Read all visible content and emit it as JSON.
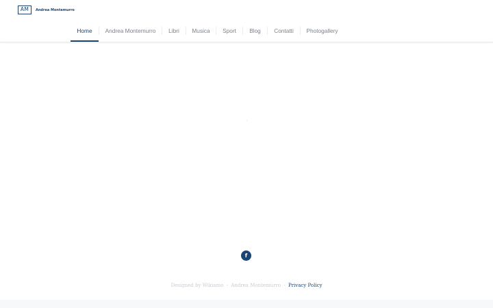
{
  "logo": {
    "mark": "AM",
    "text": "Andrea Montemurro"
  },
  "nav": {
    "items": [
      {
        "label": "Home",
        "active": true
      },
      {
        "label": "Andrea Montemurro",
        "active": false
      },
      {
        "label": "Libri",
        "active": false
      },
      {
        "label": "Musica",
        "active": false
      },
      {
        "label": "Sport",
        "active": false
      },
      {
        "label": "Blog",
        "active": false
      },
      {
        "label": "Contatti",
        "active": false
      },
      {
        "label": "Photogallery",
        "active": false
      }
    ]
  },
  "social": {
    "facebook_glyph": "f",
    "icon": "facebook-icon"
  },
  "footer": {
    "designed_by": "Designed by Wikiamo",
    "separator": "-",
    "owner": "Andrea Montemurro",
    "privacy_label": "Privacy Policy"
  },
  "colors": {
    "brand": "#1d4470",
    "nav_text": "#7c828b",
    "footer_text": "#c9ccd1"
  }
}
